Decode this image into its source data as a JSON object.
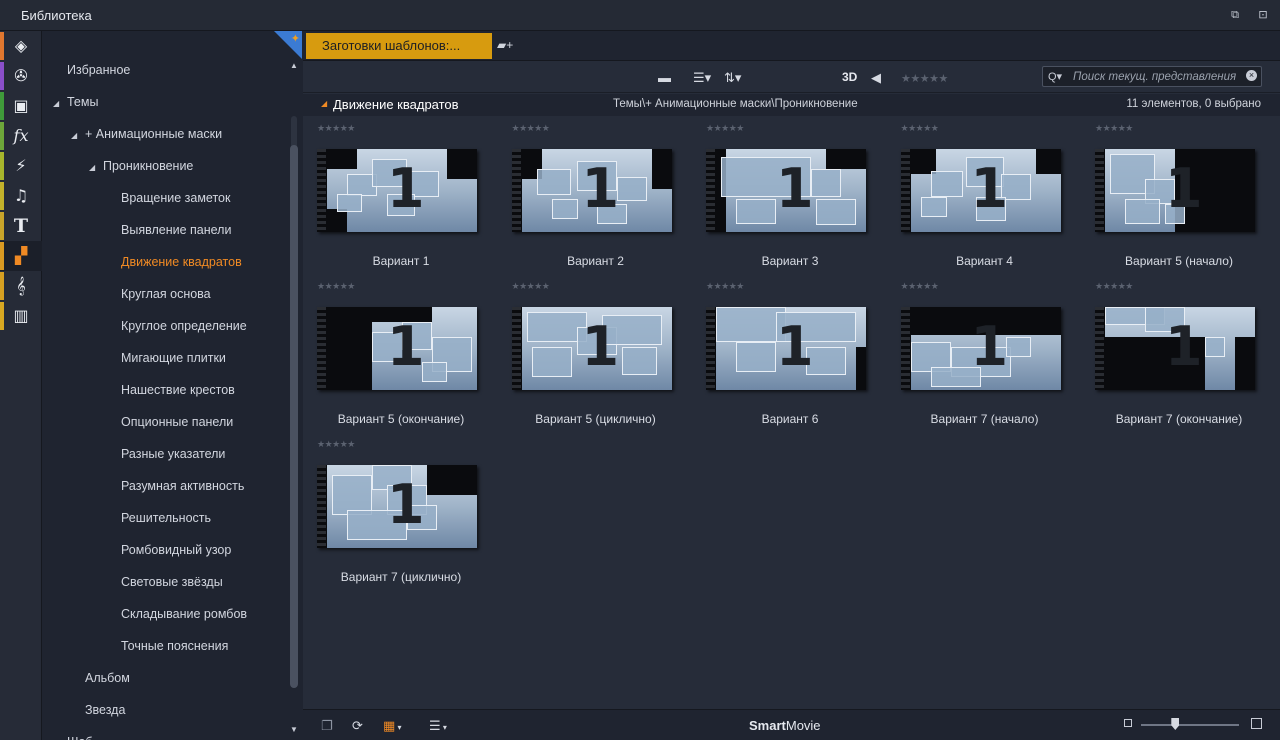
{
  "window": {
    "title": "Библиотека",
    "restore_icon": "restore-icon",
    "detach_icon": "detach-icon"
  },
  "rail": {
    "items": [
      {
        "icon": "package-icon",
        "glyph": "◈",
        "color": "#e0772f"
      },
      {
        "icon": "film-reel-icon",
        "glyph": "✇",
        "color": "#8a4fc9"
      },
      {
        "icon": "photos-icon",
        "glyph": "▣",
        "color": "#3f9a3a"
      },
      {
        "icon": "effects-icon",
        "glyph": "fx",
        "color": "#6da63a"
      },
      {
        "icon": "lightning-icon",
        "glyph": "⚡",
        "color": "#a7b52c"
      },
      {
        "icon": "music-note-icon",
        "glyph": "♫",
        "color": "#c3b22b"
      },
      {
        "icon": "title-icon",
        "glyph": "T",
        "color": "#c8a42a"
      },
      {
        "icon": "montage-icon",
        "glyph": "▞",
        "color": "#d99a22"
      },
      {
        "icon": "clef-icon",
        "glyph": "𝄞",
        "color": "#d6a022"
      },
      {
        "icon": "piano-icon",
        "glyph": "▥",
        "color": "#d8a822"
      }
    ]
  },
  "tree": {
    "rows": [
      {
        "label": "Избранное",
        "arrow": ""
      },
      {
        "label": "Темы",
        "arrow": "◢"
      },
      {
        "label": "+ Анимационные маски",
        "arrow": "◢"
      },
      {
        "label": "Проникновение",
        "arrow": "◢"
      },
      {
        "label": "Вращение заметок",
        "arrow": ""
      },
      {
        "label": "Выявление панели",
        "arrow": ""
      },
      {
        "label": "Движение квадратов",
        "arrow": ""
      },
      {
        "label": "Круглая основа",
        "arrow": ""
      },
      {
        "label": "Круглое определение",
        "arrow": ""
      },
      {
        "label": "Мигающие плитки",
        "arrow": ""
      },
      {
        "label": "Нашествие крестов",
        "arrow": ""
      },
      {
        "label": "Опционные панели",
        "arrow": ""
      },
      {
        "label": "Разные указатели",
        "arrow": ""
      },
      {
        "label": "Разумная активность",
        "arrow": ""
      },
      {
        "label": "Решительность",
        "arrow": ""
      },
      {
        "label": "Ромбовидный узор",
        "arrow": ""
      },
      {
        "label": "Световые звёзды",
        "arrow": ""
      },
      {
        "label": "Складывание ромбов",
        "arrow": ""
      },
      {
        "label": "Точные пояснения",
        "arrow": ""
      },
      {
        "label": "Альбом",
        "arrow": ""
      },
      {
        "label": "Звезда",
        "arrow": ""
      },
      {
        "label": "Шаб",
        "arrow": "▸"
      }
    ],
    "selected_index": 6
  },
  "tabs": {
    "active_label": "Заготовки шаблонов:...",
    "add_icon": "add-tab-icon"
  },
  "toolbar": {
    "folder_icon": "folder-icon",
    "list_icon": "list-view-icon",
    "sort_icon": "sort-icon",
    "label_3d": "3D",
    "tag_icon": "tag-icon",
    "rating_stars": "★★★★★",
    "search_placeholder": "Поиск текущ. представления"
  },
  "pathbar": {
    "name": "Движение квадратов",
    "path": "Темы\\+ Анимационные маски\\Проникновение",
    "count": "11 элементов, 0 выбрано"
  },
  "items": [
    {
      "label": "Вариант 1",
      "stars": "★★★★★"
    },
    {
      "label": "Вариант 2",
      "stars": "★★★★★"
    },
    {
      "label": "Вариант 3",
      "stars": "★★★★★"
    },
    {
      "label": "Вариант 4",
      "stars": "★★★★★"
    },
    {
      "label": "Вариант 5 (начало)",
      "stars": "★★★★★"
    },
    {
      "label": "Вариант 5 (окончание)",
      "stars": "★★★★★"
    },
    {
      "label": "Вариант 5 (циклично)",
      "stars": "★★★★★"
    },
    {
      "label": "Вариант 6",
      "stars": "★★★★★"
    },
    {
      "label": "Вариант 7 (начало)",
      "stars": "★★★★★"
    },
    {
      "label": "Вариант 7 (окончание)",
      "stars": "★★★★★"
    },
    {
      "label": "Вариант 7 (циклично)",
      "stars": "★★★★★"
    }
  ],
  "statusbar": {
    "smart": "Smart",
    "movie": "Movie",
    "copy_icon": "copy-icon",
    "sync_icon": "sync-icon",
    "grid_icon": "grid-view-icon",
    "menu_icon": "menu-icon"
  },
  "zoom": {
    "level": 0.35
  },
  "colors": {
    "accent_orange": "#f08a24",
    "tab_gold": "#d79b0f",
    "corner_blue": "#3b7bd3"
  }
}
